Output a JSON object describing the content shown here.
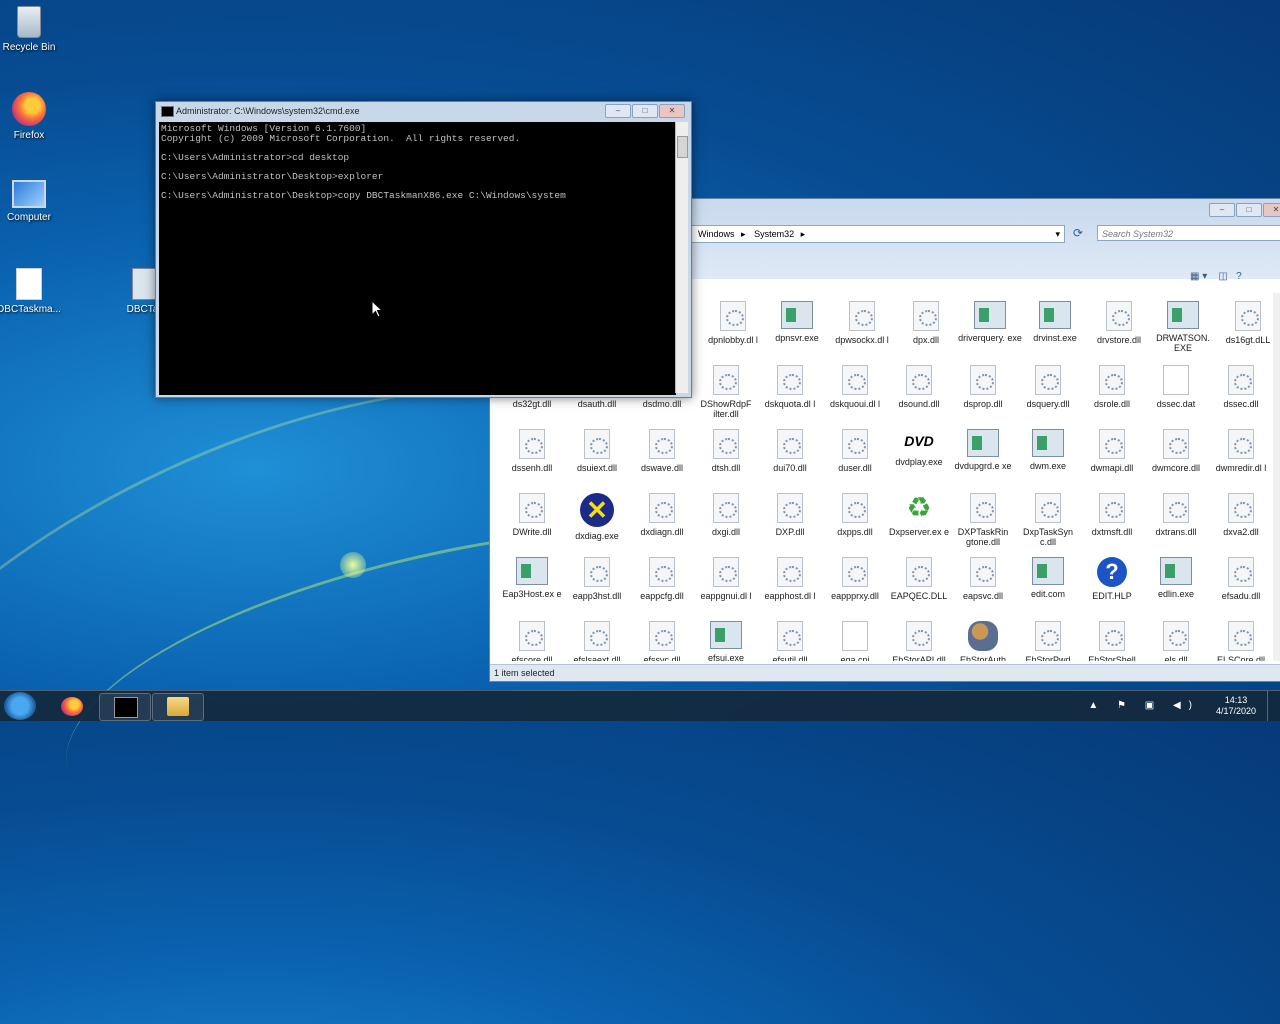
{
  "desktop": {
    "icons": [
      {
        "label": "Recycle Bin",
        "icon": "recycle-bin-icon"
      },
      {
        "label": "Firefox",
        "icon": "firefox-icon"
      },
      {
        "label": "Computer",
        "icon": "computer-icon"
      },
      {
        "label": "DBCTaskma...",
        "icon": "file-icon"
      },
      {
        "label": "DBCTas",
        "icon": "exe-icon"
      }
    ]
  },
  "cmd": {
    "title": "Administrator: C:\\Windows\\system32\\cmd.exe",
    "lines": [
      "Microsoft Windows [Version 6.1.7600]",
      "Copyright (c) 2009 Microsoft Corporation.  All rights reserved.",
      "",
      "C:\\Users\\Administrator>cd desktop",
      "",
      "C:\\Users\\Administrator\\Desktop>explorer",
      "",
      "C:\\Users\\Administrator\\Desktop>copy DBCTaskmanX86.exe C:\\Windows\\system"
    ],
    "buttons": {
      "minimize": "–",
      "maximize": "□",
      "close": "✕"
    }
  },
  "explorer": {
    "breadcrumb": [
      "Windows",
      "System32"
    ],
    "search_placeholder": "Search System32",
    "status": "1 item selected",
    "files": [
      {
        "name": "dpnlobby.dl l",
        "type": "dll"
      },
      {
        "name": "dpnsvr.exe",
        "type": "exe"
      },
      {
        "name": "dpwsockx.dl l",
        "type": "dll"
      },
      {
        "name": "dpx.dll",
        "type": "dll"
      },
      {
        "name": "driverquery. exe",
        "type": "exe"
      },
      {
        "name": "drvinst.exe",
        "type": "exe"
      },
      {
        "name": "drvstore.dll",
        "type": "dll"
      },
      {
        "name": "DRWATSON. EXE",
        "type": "exe"
      },
      {
        "name": "ds16gt.dLL",
        "type": "dll"
      },
      {
        "name": "ds32gt.dll",
        "type": "dll"
      },
      {
        "name": "dsauth.dll",
        "type": "dll"
      },
      {
        "name": "dsdmo.dll",
        "type": "dll"
      },
      {
        "name": "DShowRdpF ilter.dll",
        "type": "dll"
      },
      {
        "name": "dskquota.dl l",
        "type": "dll"
      },
      {
        "name": "dskquoui.dl l",
        "type": "dll"
      },
      {
        "name": "dsound.dll",
        "type": "dll"
      },
      {
        "name": "dsprop.dll",
        "type": "dll"
      },
      {
        "name": "dsquery.dll",
        "type": "dll"
      },
      {
        "name": "dsrole.dll",
        "type": "dll"
      },
      {
        "name": "dssec.dat",
        "type": "blank"
      },
      {
        "name": "dssec.dll",
        "type": "dll"
      },
      {
        "name": "dssenh.dll",
        "type": "dll"
      },
      {
        "name": "dsuiext.dll",
        "type": "dll"
      },
      {
        "name": "dswave.dll",
        "type": "dll"
      },
      {
        "name": "dtsh.dll",
        "type": "dll"
      },
      {
        "name": "dui70.dll",
        "type": "dll"
      },
      {
        "name": "duser.dll",
        "type": "dll"
      },
      {
        "name": "dvdplay.exe",
        "type": "dvd"
      },
      {
        "name": "dvdupgrd.e xe",
        "type": "exe"
      },
      {
        "name": "dwm.exe",
        "type": "exe"
      },
      {
        "name": "dwmapi.dll",
        "type": "dll"
      },
      {
        "name": "dwmcore.dll",
        "type": "dll"
      },
      {
        "name": "dwmredir.dl l",
        "type": "dll"
      },
      {
        "name": "DWrite.dll",
        "type": "dll"
      },
      {
        "name": "dxdiag.exe",
        "type": "xdiag"
      },
      {
        "name": "dxdiagn.dll",
        "type": "dll"
      },
      {
        "name": "dxgi.dll",
        "type": "dll"
      },
      {
        "name": "DXP.dll",
        "type": "dll"
      },
      {
        "name": "dxpps.dll",
        "type": "dll"
      },
      {
        "name": "Dxpserver.ex e",
        "type": "recycle"
      },
      {
        "name": "DXPTaskRin gtone.dll",
        "type": "dll"
      },
      {
        "name": "DxpTaskSyn c.dll",
        "type": "dll"
      },
      {
        "name": "dxtmsft.dll",
        "type": "dll"
      },
      {
        "name": "dxtrans.dll",
        "type": "dll"
      },
      {
        "name": "dxva2.dll",
        "type": "dll"
      },
      {
        "name": "Eap3Host.ex e",
        "type": "exe"
      },
      {
        "name": "eapp3hst.dll",
        "type": "dll"
      },
      {
        "name": "eappcfg.dll",
        "type": "dll"
      },
      {
        "name": "eappgnui.dl l",
        "type": "dll"
      },
      {
        "name": "eapphost.dl l",
        "type": "dll"
      },
      {
        "name": "eappprxy.dll",
        "type": "dll"
      },
      {
        "name": "EAPQEC.DLL",
        "type": "dll"
      },
      {
        "name": "eapsvc.dll",
        "type": "dll"
      },
      {
        "name": "edit.com",
        "type": "exe"
      },
      {
        "name": "EDIT.HLP",
        "type": "help"
      },
      {
        "name": "edlin.exe",
        "type": "exe"
      },
      {
        "name": "efsadu.dll",
        "type": "dll"
      },
      {
        "name": "efscore.dll",
        "type": "dll"
      },
      {
        "name": "efslsaext.dll",
        "type": "dll"
      },
      {
        "name": "efssvc.dll",
        "type": "dll"
      },
      {
        "name": "efsui.exe",
        "type": "exe"
      },
      {
        "name": "efsutil.dll",
        "type": "dll"
      },
      {
        "name": "ega.cpi",
        "type": "blank"
      },
      {
        "name": "EhStorAPI.dll",
        "type": "dll"
      },
      {
        "name": "EhStorAuth",
        "type": "people"
      },
      {
        "name": "EhStorPwd",
        "type": "dll"
      },
      {
        "name": "EhStorShell",
        "type": "dll"
      },
      {
        "name": "els.dll",
        "type": "dll"
      },
      {
        "name": "ELSCore.dll",
        "type": "dll"
      }
    ]
  },
  "taskbar": {
    "time": "14:13",
    "date": "4/17/2020",
    "tray": "▲ ⚑ ▣ ◀)"
  }
}
